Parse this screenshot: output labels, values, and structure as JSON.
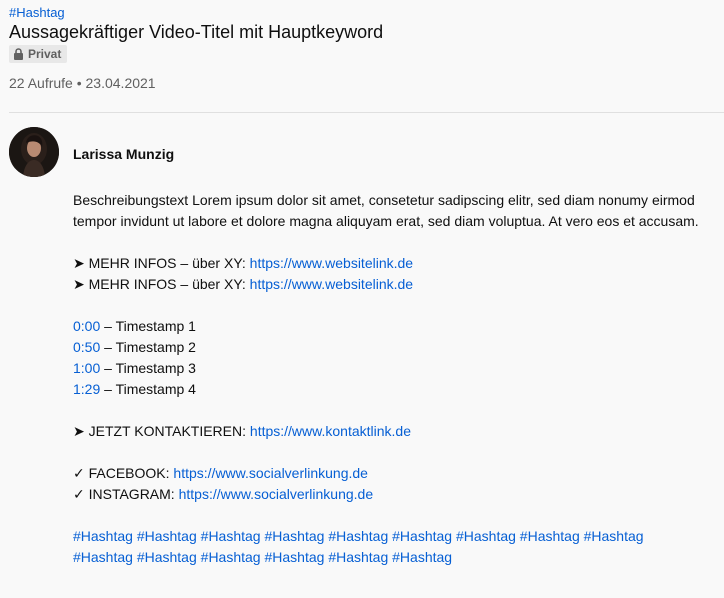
{
  "header": {
    "top_hashtag": "#Hashtag",
    "title": "Aussagekräftiger Video-Titel mit Hauptkeyword",
    "badge_label": "Privat",
    "badge_icon": "lock-icon",
    "views": "22 Aufrufe",
    "separator": "•",
    "date": "23.04.2021"
  },
  "channel": {
    "name": "Larissa Munzig"
  },
  "description": {
    "text": "Beschreibungstext Lorem ipsum dolor sit amet, consetetur sadipscing elitr, sed diam nonumy eirmod tempor invidunt ut labore et dolore magna aliquyam erat, sed diam voluptua. At vero eos et accusam.",
    "more_info": [
      {
        "prefix": "➤ MEHR INFOS – über XY: ",
        "link": "https://www.websitelink.de"
      },
      {
        "prefix": "➤ MEHR INFOS – über XY: ",
        "link": "https://www.websitelink.de"
      }
    ],
    "timestamps": [
      {
        "time": "0:00",
        "label": " – Timestamp 1"
      },
      {
        "time": "0:50",
        "label": " – Timestamp 2"
      },
      {
        "time": "1:00",
        "label": " – Timestamp 3"
      },
      {
        "time": "1:29",
        "label": " – Timestamp 4"
      }
    ],
    "contact": {
      "prefix": "➤ JETZT KONTAKTIEREN: ",
      "link": "https://www.kontaktlink.de"
    },
    "social": [
      {
        "prefix": "✓ FACEBOOK: ",
        "link": "https://www.socialverlinkung.de"
      },
      {
        "prefix": "✓ INSTAGRAM: ",
        "link": "https://www.socialverlinkung.de"
      }
    ],
    "hashtags_line1": [
      "#Hashtag",
      "#Hashtag",
      "#Hashtag",
      "#Hashtag",
      "#Hashtag",
      "#Hashtag",
      "#Hashtag",
      "#Hashtag",
      "#Hashtag"
    ],
    "hashtags_line2": [
      "#Hashtag",
      "#Hashtag",
      "#Hashtag",
      "#Hashtag",
      "#Hashtag",
      "#Hashtag"
    ]
  },
  "colors": {
    "link": "#065fd4",
    "background": "#f9f9f9",
    "secondary_text": "#606060"
  }
}
